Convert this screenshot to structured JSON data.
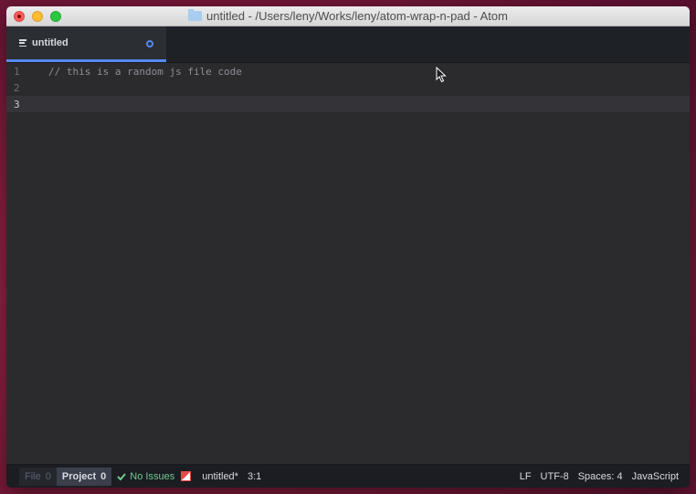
{
  "window": {
    "title": "untitled - /Users/leny/Works/leny/atom-wrap-n-pad - Atom"
  },
  "tabs": [
    {
      "label": "untitled",
      "icon": "file-text-icon",
      "modified": true
    }
  ],
  "editor": {
    "lines": [
      {
        "number": "1",
        "text": "// this is a random js file code"
      },
      {
        "number": "2",
        "text": ""
      },
      {
        "number": "3",
        "text": ""
      }
    ]
  },
  "statusbar": {
    "file_label": "File",
    "file_count": "0",
    "project_label": "Project",
    "project_count": "0",
    "issues": "No Issues",
    "filename": "untitled*",
    "cursor_position": "3:1",
    "line_ending": "LF",
    "encoding": "UTF-8",
    "indentation": "Spaces: 4",
    "grammar": "JavaScript"
  },
  "colors": {
    "accent": "#568af2",
    "ok": "#73c990"
  }
}
